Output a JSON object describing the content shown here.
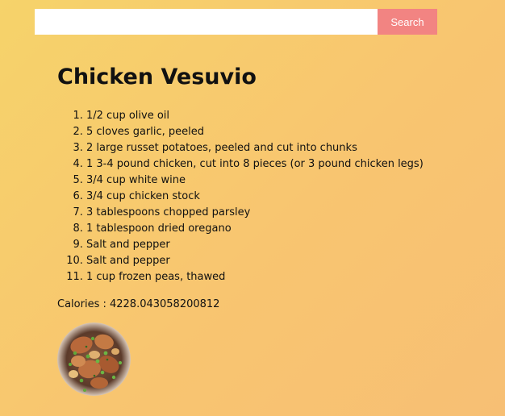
{
  "search": {
    "value": "",
    "placeholder": "",
    "button_label": "Search"
  },
  "recipe": {
    "title": "Chicken Vesuvio",
    "ingredients": [
      "1/2 cup olive oil",
      "5 cloves garlic, peeled",
      "2 large russet potatoes, peeled and cut into chunks",
      "1 3-4 pound chicken, cut into 8 pieces (or 3 pound chicken legs)",
      "3/4 cup white wine",
      "3/4 cup chicken stock",
      "3 tablespoons chopped parsley",
      "1 tablespoon dried oregano",
      "Salt and pepper",
      "Salt and pepper",
      "1 cup frozen peas, thawed"
    ],
    "calories_label": "Calories : 4228.043058200812"
  },
  "colors": {
    "background_start": "#f6d36a",
    "background_end": "#f7bf74",
    "search_button": "#f28482"
  }
}
